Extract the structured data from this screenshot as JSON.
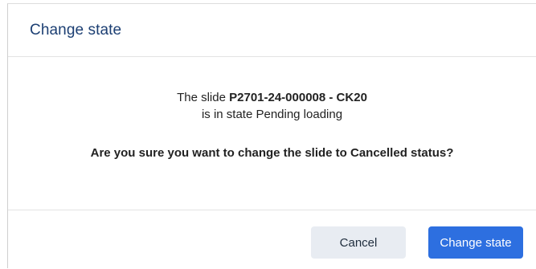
{
  "dialog": {
    "title": "Change state",
    "body": {
      "prefix": "The slide ",
      "slide_id": "P2701-24-000008 - CK20",
      "state_text": "is in state Pending loading",
      "question": "Are you sure you want to change the slide to Cancelled status?"
    },
    "buttons": {
      "cancel_label": "Cancel",
      "confirm_label": "Change state"
    }
  },
  "colors": {
    "title": "#1c3f73",
    "primary_button": "#2d6fe0",
    "cancel_button": "#e8ecf2"
  }
}
